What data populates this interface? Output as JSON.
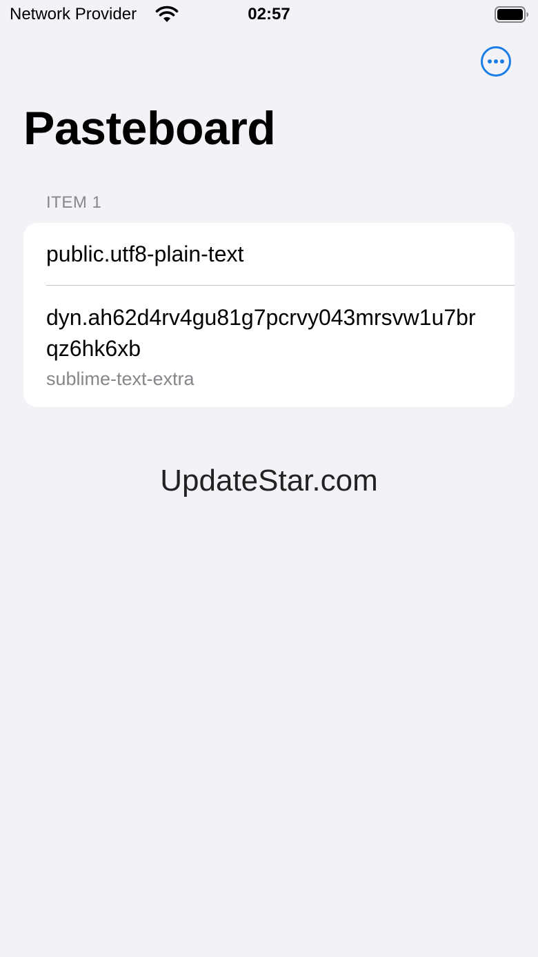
{
  "status_bar": {
    "carrier": "Network Provider",
    "time": "02:57",
    "wifi_icon": "wifi-icon",
    "battery_icon": "battery-full-icon"
  },
  "nav": {
    "more_icon": "ellipsis-circle-icon",
    "accent_color": "#1a7ee6"
  },
  "page": {
    "title": "Pasteboard"
  },
  "sections": [
    {
      "header": "ITEM 1",
      "rows": [
        {
          "title": "public.utf8-plain-text"
        },
        {
          "title": "dyn.ah62d4rv4gu81g7pcrvy043mrsvw1u7brqz6hk6xb",
          "subtitle": "sublime-text-extra"
        }
      ]
    }
  ],
  "watermark": "UpdateStar.com"
}
